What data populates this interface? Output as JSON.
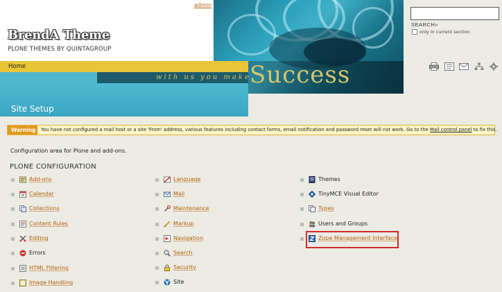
{
  "header": {
    "user": "admin",
    "logo_title": "BrendA Theme",
    "logo_subtitle": "PLONE THEMES BY QUINTAGROUP",
    "banner_word": "Success",
    "tagline": "with us you make"
  },
  "nav": {
    "home": "Home"
  },
  "page_title": "Site Setup",
  "search": {
    "placeholder": "",
    "button_label": "SEARCH",
    "button_arrow": "»",
    "only_current": "only in current section"
  },
  "site_actions": [
    "print-icon",
    "sitemap-icon",
    "mail-icon",
    "tree-icon",
    "gear-icon"
  ],
  "warning": {
    "label": "Warning",
    "text_before": "You have not configured a mail host or a site 'From' address, various features including contact forms, email notification and password reset will not work. Go to the ",
    "link": "Mail control panel",
    "text_after": " to fix this."
  },
  "intro": "Configuration area for Plone and add-ons.",
  "section_title": "PLONE CONFIGURATION",
  "config": {
    "col1": [
      {
        "label": "Add-ons",
        "icon": "addons-icon"
      },
      {
        "label": "Calendar",
        "icon": "calendar-icon"
      },
      {
        "label": "Collections",
        "icon": "collections-icon"
      },
      {
        "label": "Content Rules",
        "icon": "content-rules-icon"
      },
      {
        "label": "Editing",
        "icon": "editing-icon"
      },
      {
        "label": "Errors",
        "icon": "errors-icon"
      },
      {
        "label": "HTML Filtering",
        "icon": "html-filtering-icon"
      },
      {
        "label": "Image Handling",
        "icon": "image-handling-icon"
      }
    ],
    "col2": [
      {
        "label": "Language",
        "icon": "language-icon"
      },
      {
        "label": "Mail",
        "icon": "mail-icon"
      },
      {
        "label": "Maintenance",
        "icon": "maintenance-icon"
      },
      {
        "label": "Markup",
        "icon": "markup-icon"
      },
      {
        "label": "Navigation",
        "icon": "navigation-icon"
      },
      {
        "label": "Search",
        "icon": "search-icon"
      },
      {
        "label": "Security",
        "icon": "security-icon"
      },
      {
        "label": "Site",
        "icon": "site-icon"
      }
    ],
    "col3": [
      {
        "label": "Themes",
        "icon": "themes-icon"
      },
      {
        "label": "TinyMCE Visual Editor",
        "icon": "tinymce-icon"
      },
      {
        "label": "Types",
        "icon": "types-icon"
      },
      {
        "label": "Users and Groups",
        "icon": "users-groups-icon"
      },
      {
        "label": "Zope Management Interface",
        "icon": "zmi-icon"
      }
    ]
  },
  "colors": {
    "link": "#b5600a",
    "nav_yellow": "#e8c637",
    "title_band": "#4fb8d0",
    "warning_bg": "#fdf6c6",
    "warning_label": "#e09a1f",
    "highlight": "#d12b2b"
  }
}
